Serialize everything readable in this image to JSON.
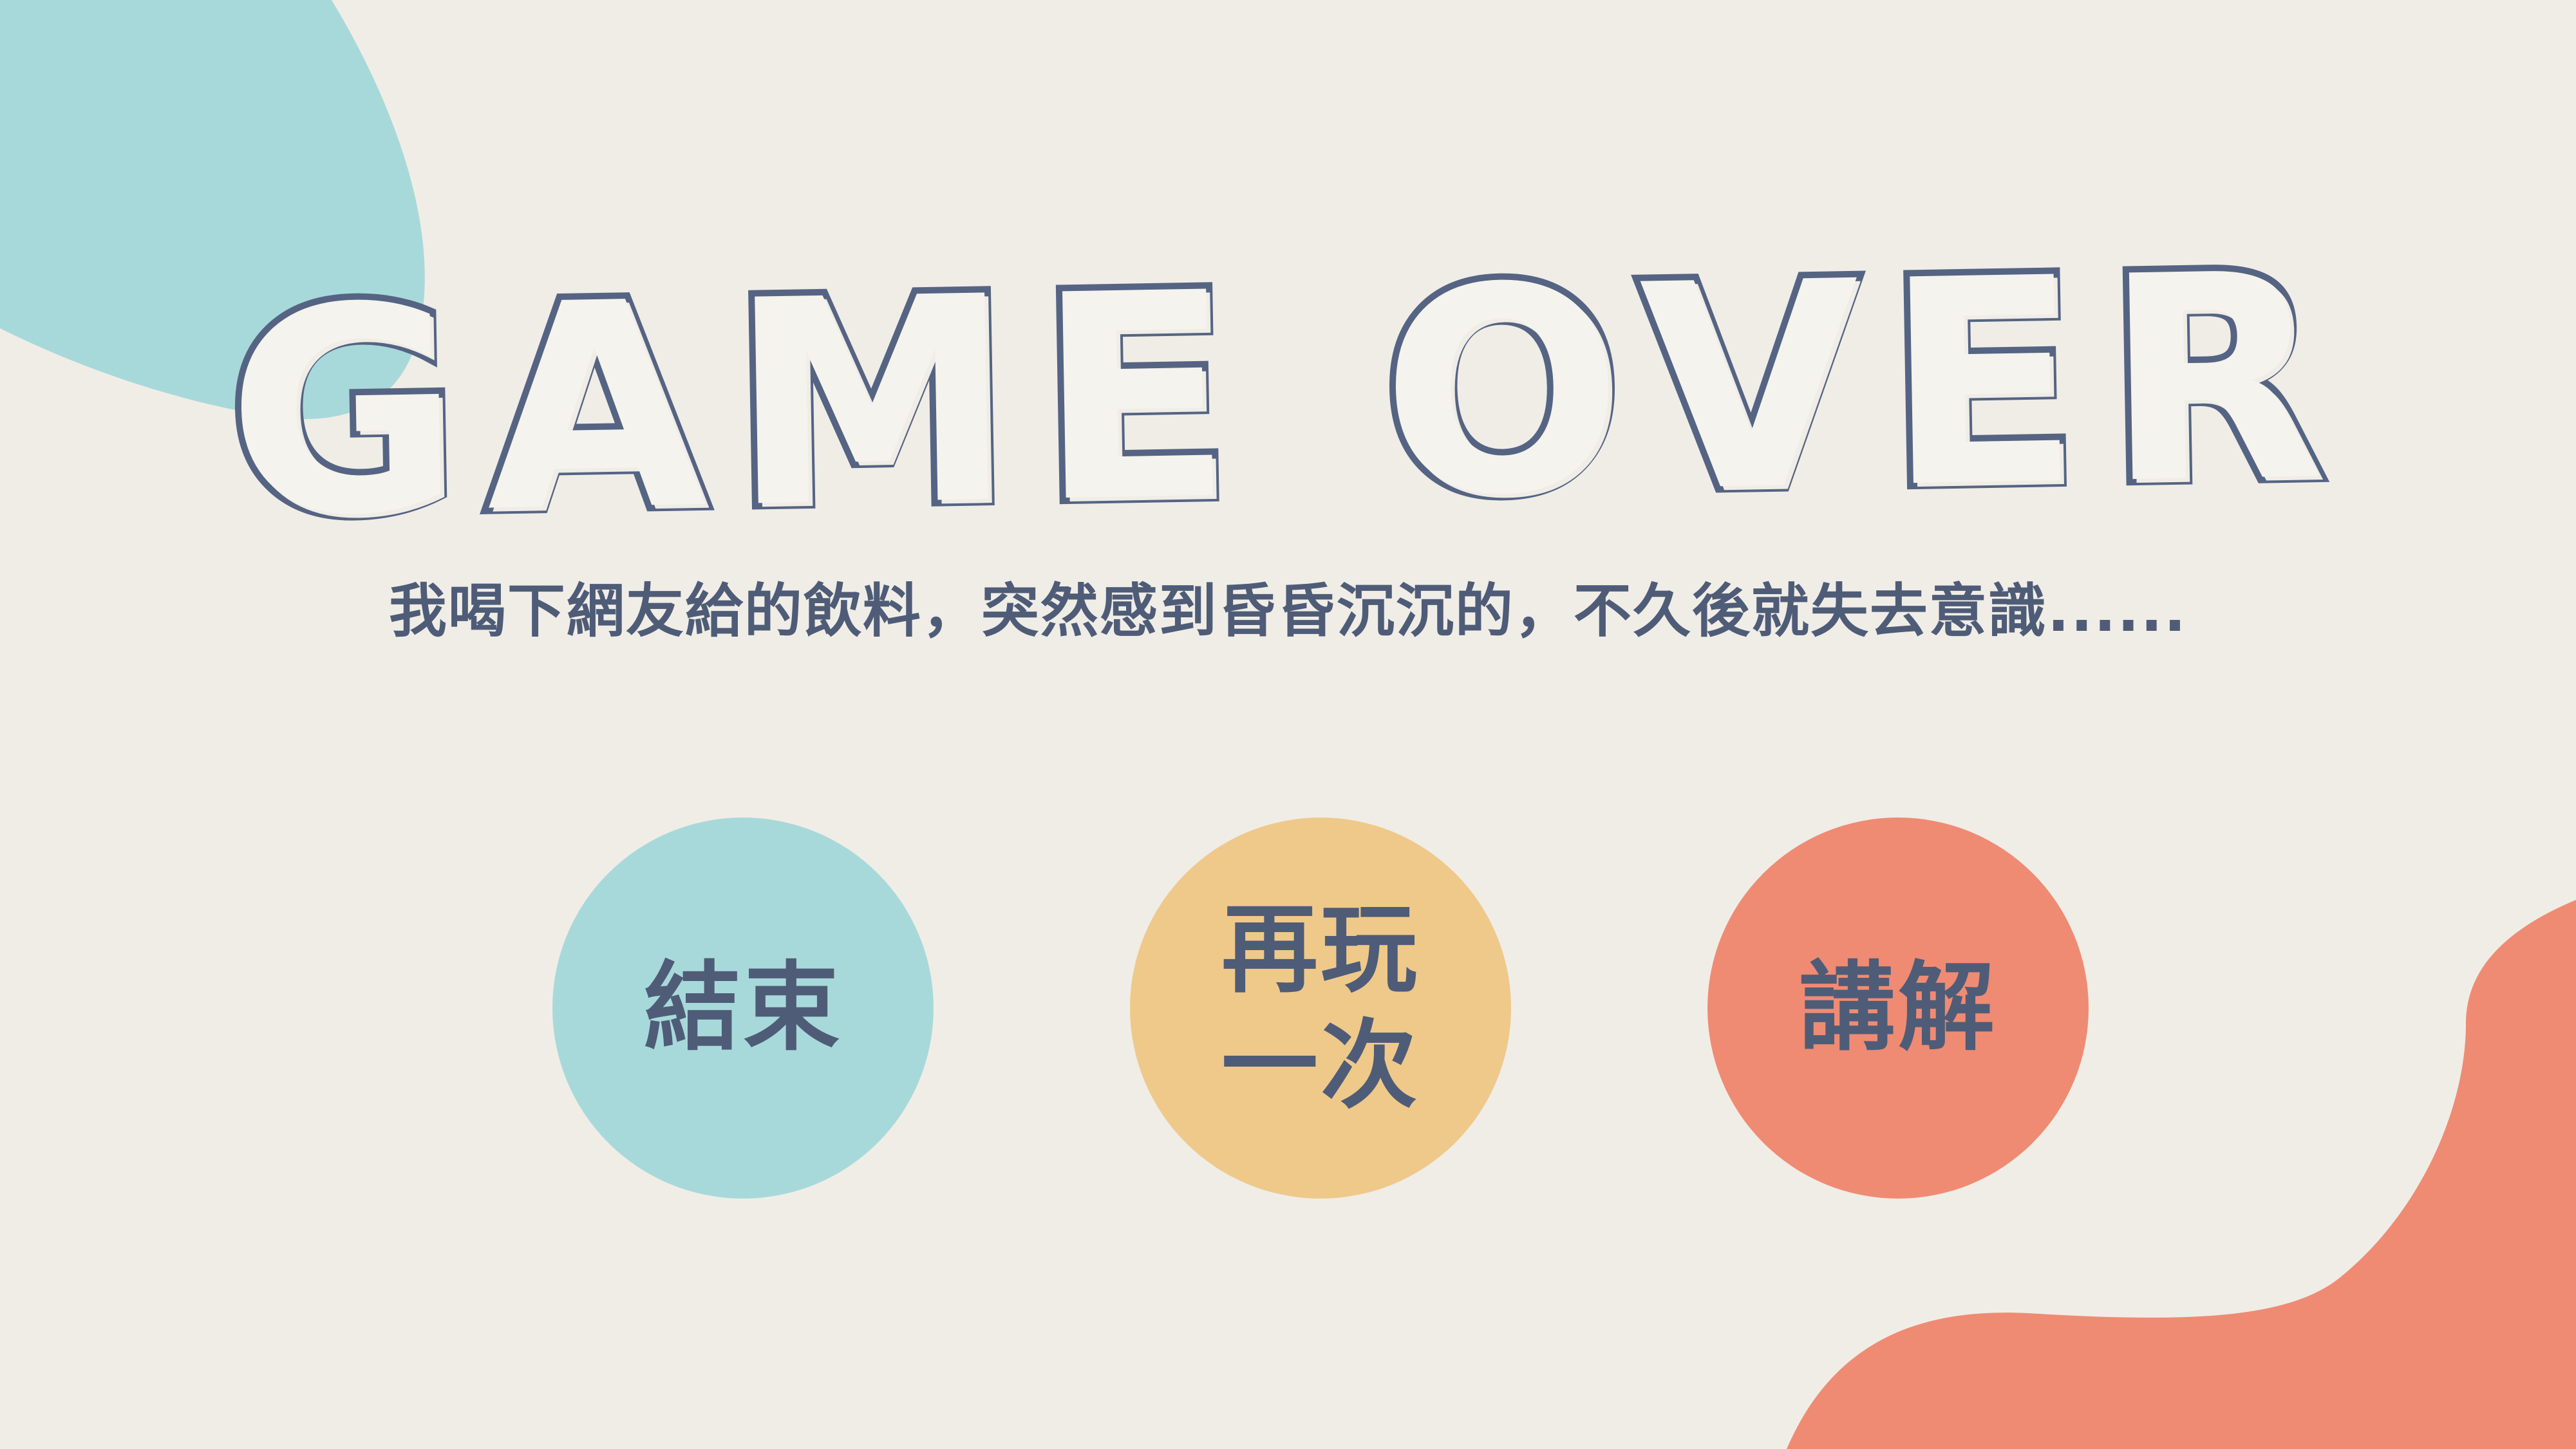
{
  "title": "GAME OVER",
  "message": "我喝下網友給的飲料，突然感到昏昏沉沉的，不久後就失去意識......",
  "buttons": [
    {
      "label": "結束",
      "color": "#a8d9da"
    },
    {
      "label": "再玩\n一次",
      "color": "#efc98a"
    },
    {
      "label": "講解",
      "color": "#ef8b73"
    }
  ],
  "colors": {
    "background": "#f0ede7",
    "text": "#4f5c77",
    "blob_top_left": "#a8d9da",
    "blob_bottom_right": "#ef8b73"
  }
}
